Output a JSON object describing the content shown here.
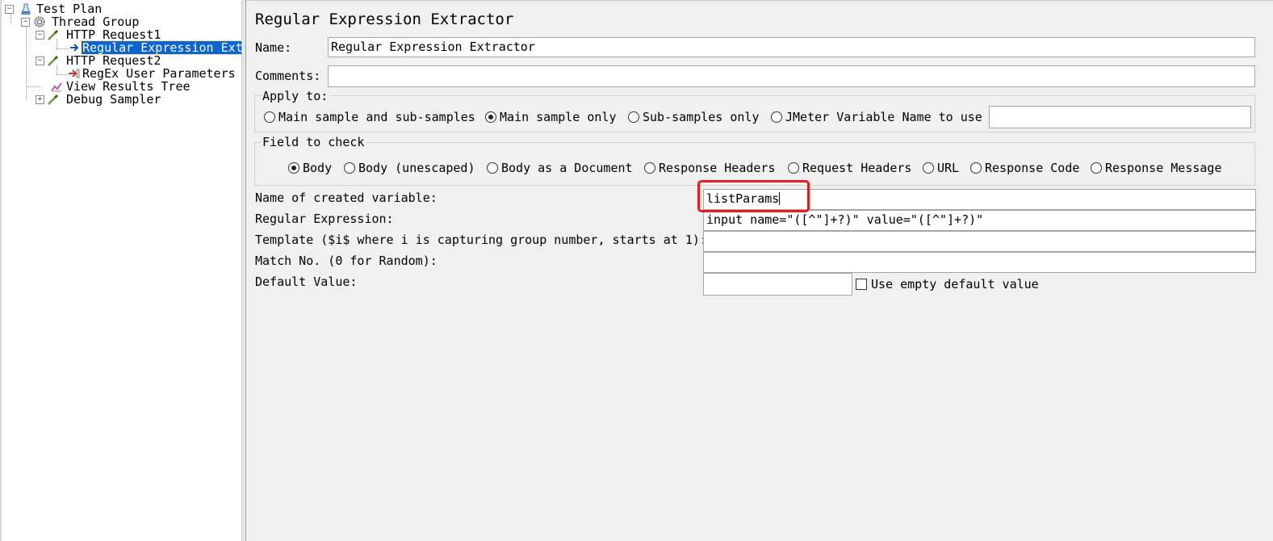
{
  "tree": {
    "test_plan": "Test Plan",
    "thread_group": "Thread Group",
    "http_request1": "HTTP Request1",
    "regex_extractor": "Regular Expression Ext",
    "http_request2": "HTTP Request2",
    "regex_user_params": "RegEx User Parameters",
    "view_results_tree": "View Results Tree",
    "debug_sampler": "Debug Sampler"
  },
  "panel": {
    "title": "Regular Expression Extractor",
    "name_label": "Name:",
    "name_value": "Regular Expression Extractor",
    "comments_label": "Comments:",
    "comments_value": "",
    "apply_to": {
      "legend": "Apply to:",
      "options": [
        "Main sample and sub-samples",
        "Main sample only",
        "Sub-samples only",
        "JMeter Variable Name to use"
      ],
      "selected": "Main sample only",
      "variable_value": ""
    },
    "field_to_check": {
      "legend": "Field to check",
      "options": [
        "Body",
        "Body (unescaped)",
        "Body as a Document",
        "Response Headers",
        "Request Headers",
        "URL",
        "Response Code",
        "Response Message"
      ],
      "selected": "Body"
    },
    "fields": {
      "var_name_label": "Name of created variable:",
      "var_name_value": "listParams",
      "regex_label": "Regular Expression:",
      "regex_value": "input name=\"([^\"]+?)\" value=\"([^\"]+?)\"",
      "template_label": "Template ($i$ where i is capturing group number, starts at 1):",
      "template_value": "",
      "match_label": "Match No. (0 for Random):",
      "match_value": "",
      "default_label": "Default Value:",
      "default_value": "",
      "use_empty_label": "Use empty default value",
      "use_empty_checked": false
    }
  },
  "colors": {
    "selection": "#0a64d6",
    "highlight_box": "#e02020",
    "panel_bg": "#f0f0f0"
  },
  "icons": {
    "test_plan": "flask-icon",
    "thread_group": "gear-icon",
    "http_request": "pipette-icon",
    "extractor": "arrow-right-icon",
    "user_params": "arrow-in-icon",
    "results_tree": "chart-icon",
    "debug_sampler": "pipette-icon"
  }
}
